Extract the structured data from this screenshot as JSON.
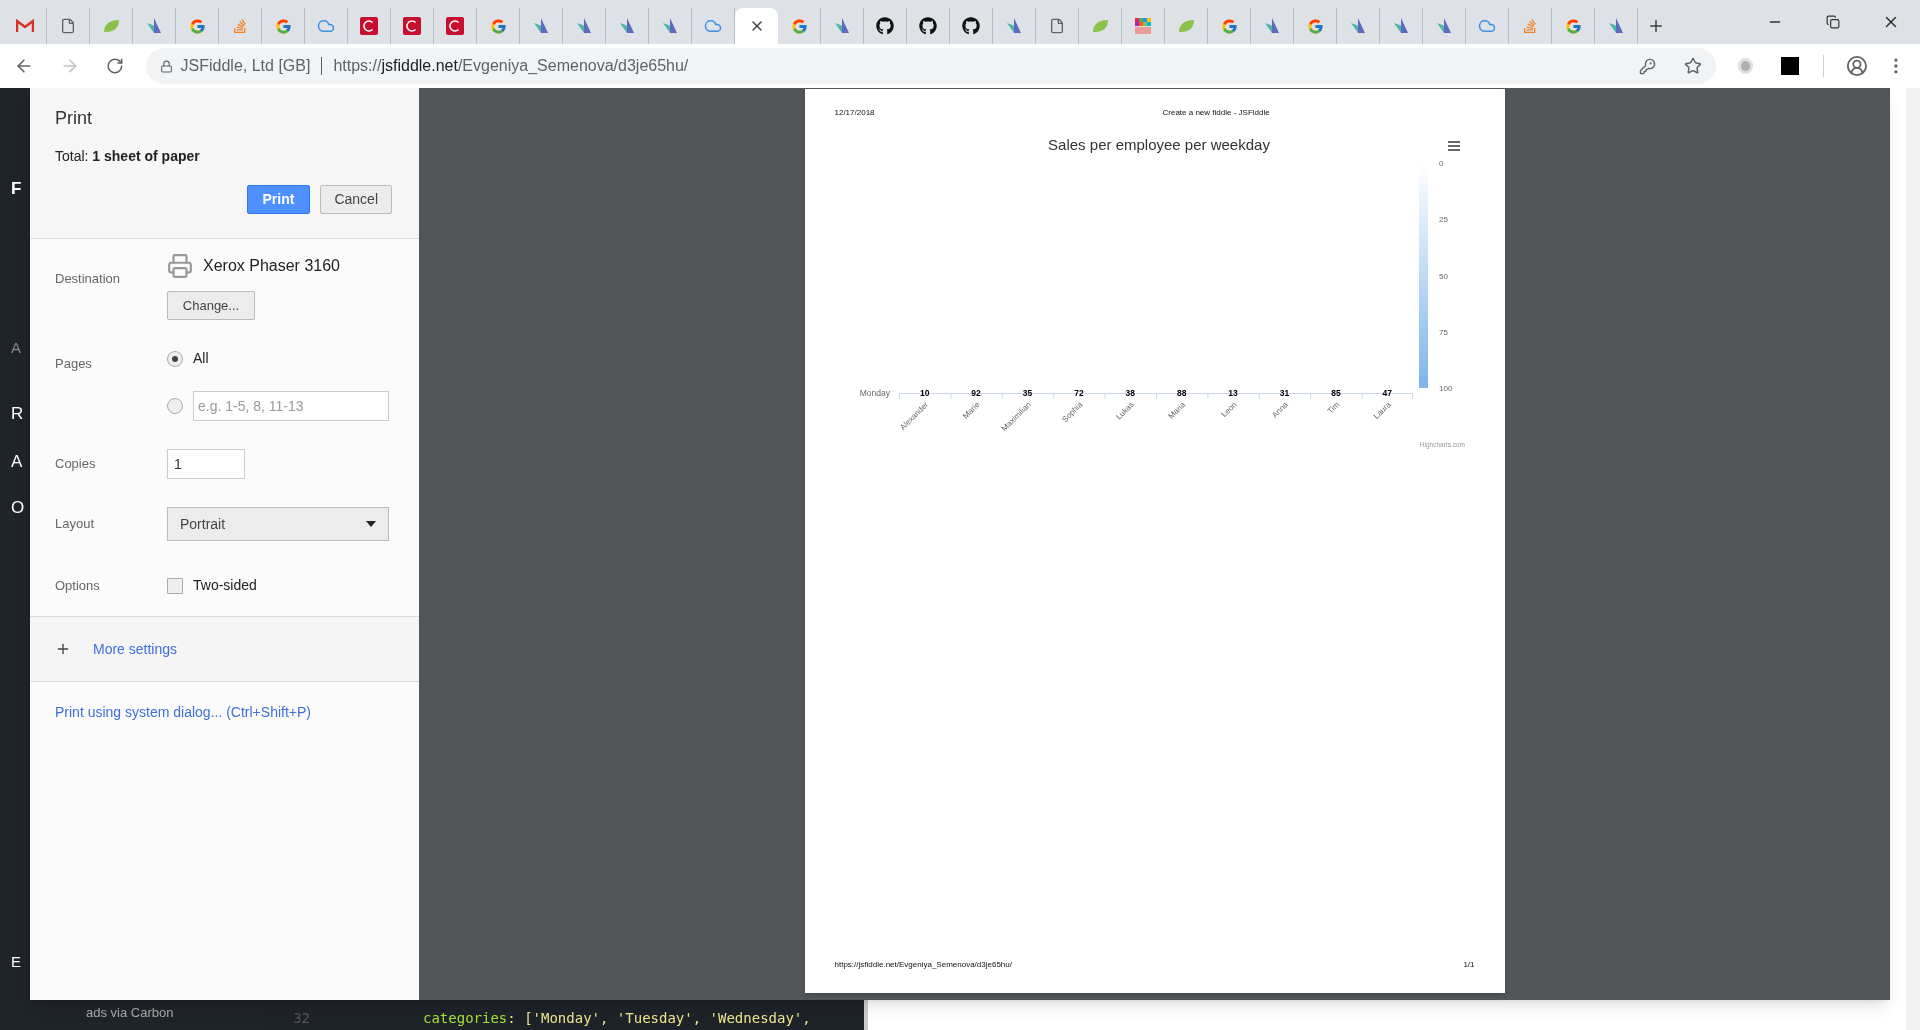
{
  "browser": {
    "tabs": [
      {
        "kind": "gmail",
        "selected": false
      },
      {
        "kind": "doc",
        "selected": false
      },
      {
        "kind": "leaf",
        "selected": false
      },
      {
        "kind": "arrow",
        "selected": false
      },
      {
        "kind": "google",
        "selected": false
      },
      {
        "kind": "stack",
        "selected": false
      },
      {
        "kind": "google",
        "selected": false
      },
      {
        "kind": "cloud",
        "selected": false
      },
      {
        "kind": "c",
        "selected": false
      },
      {
        "kind": "c",
        "selected": false
      },
      {
        "kind": "c",
        "selected": false
      },
      {
        "kind": "google",
        "selected": false
      },
      {
        "kind": "arrow",
        "selected": false
      },
      {
        "kind": "arrow",
        "selected": false
      },
      {
        "kind": "arrow",
        "selected": false
      },
      {
        "kind": "arrow",
        "selected": false
      },
      {
        "kind": "cloud",
        "selected": false
      },
      {
        "selected": true
      },
      {
        "kind": "google",
        "selected": false
      },
      {
        "kind": "arrow",
        "selected": false
      },
      {
        "kind": "github",
        "selected": false
      },
      {
        "kind": "github",
        "selected": false
      },
      {
        "kind": "github",
        "selected": false
      },
      {
        "kind": "arrow",
        "selected": false
      },
      {
        "kind": "doc",
        "selected": false
      },
      {
        "kind": "leaf",
        "selected": false
      },
      {
        "kind": "pixel",
        "selected": false
      },
      {
        "kind": "leaf",
        "selected": false
      },
      {
        "kind": "google",
        "selected": false
      },
      {
        "kind": "arrow",
        "selected": false
      },
      {
        "kind": "google",
        "selected": false
      },
      {
        "kind": "arrow",
        "selected": false
      },
      {
        "kind": "arrow",
        "selected": false
      },
      {
        "kind": "arrow",
        "selected": false
      },
      {
        "kind": "cloud",
        "selected": false
      },
      {
        "kind": "stack",
        "selected": false
      },
      {
        "kind": "google",
        "selected": false
      },
      {
        "kind": "arrow",
        "selected": false
      }
    ],
    "address_bar": {
      "site_identity": "JSFiddle, Ltd [GB]",
      "url": {
        "scheme": "https://",
        "host": "jsfiddle.net",
        "path": "/Evgeniya_Semenova/d3je65hu/"
      }
    }
  },
  "background": {
    "sidebar_fragments": [
      "F",
      "A",
      "R",
      "A",
      "O",
      "E"
    ],
    "sidebar_footer": "ads via Carbon",
    "code_lines": [
      {
        "number": "32",
        "key": "categories",
        "rest": ": ['Monday', 'Tuesday', 'Wednesday',"
      }
    ]
  },
  "print_dialog": {
    "title": "Print",
    "total": "Total: **1 sheet of paper**",
    "buttons": [
      {
        "label": "Print",
        "kind": "primary"
      },
      {
        "label": "Cancel",
        "kind": "secondary"
      }
    ],
    "destination": {
      "label": "Destination",
      "printer": "Xerox Phaser 3160",
      "change_button": "Change..."
    },
    "pages": {
      "label": "Pages",
      "options": [
        {
          "kind": "all",
          "label": "All",
          "selected": true
        },
        {
          "kind": "range",
          "placeholder": "e.g. 1-5, 8, 11-13",
          "selected": false
        }
      ]
    },
    "copies": {
      "label": "Copies",
      "value": "1"
    },
    "layout": {
      "label": "Layout",
      "value": "Portrait"
    },
    "options": {
      "label": "Options",
      "checkboxes": [
        {
          "label": "Two-sided",
          "checked": false
        }
      ]
    },
    "more_settings": {
      "label": "More settings",
      "expanded": false
    },
    "system_dialog_link": "Print using system dialog... (Ctrl+Shift+P)"
  },
  "preview": {
    "header_left": "12/17/2018",
    "header_center": "Create a new fiddle - JSFiddle",
    "footer_left": "https://jsfiddle.net/Evgeniya_Semenova/d3je65hu/",
    "footer_right": "1/1",
    "chart": {
      "credits": "Highcharts.com",
      "color_axis_ticks": [
        "0",
        "25",
        "50",
        "75",
        "100"
      ],
      "title": "Sales per employee per weekday",
      "row_label": "Monday",
      "cells": [
        {
          "category": "Alexander",
          "value": "10"
        },
        {
          "category": "Marie",
          "value": "92"
        },
        {
          "category": "Maximilian",
          "value": "35"
        },
        {
          "category": "Sophia",
          "value": "72"
        },
        {
          "category": "Lukas",
          "value": "38"
        },
        {
          "category": "Maria",
          "value": "88"
        },
        {
          "category": "Leon",
          "value": "13"
        },
        {
          "category": "Anna",
          "value": "31"
        },
        {
          "category": "Tim",
          "value": "85"
        },
        {
          "category": "Laura",
          "value": "47"
        }
      ]
    }
  }
}
